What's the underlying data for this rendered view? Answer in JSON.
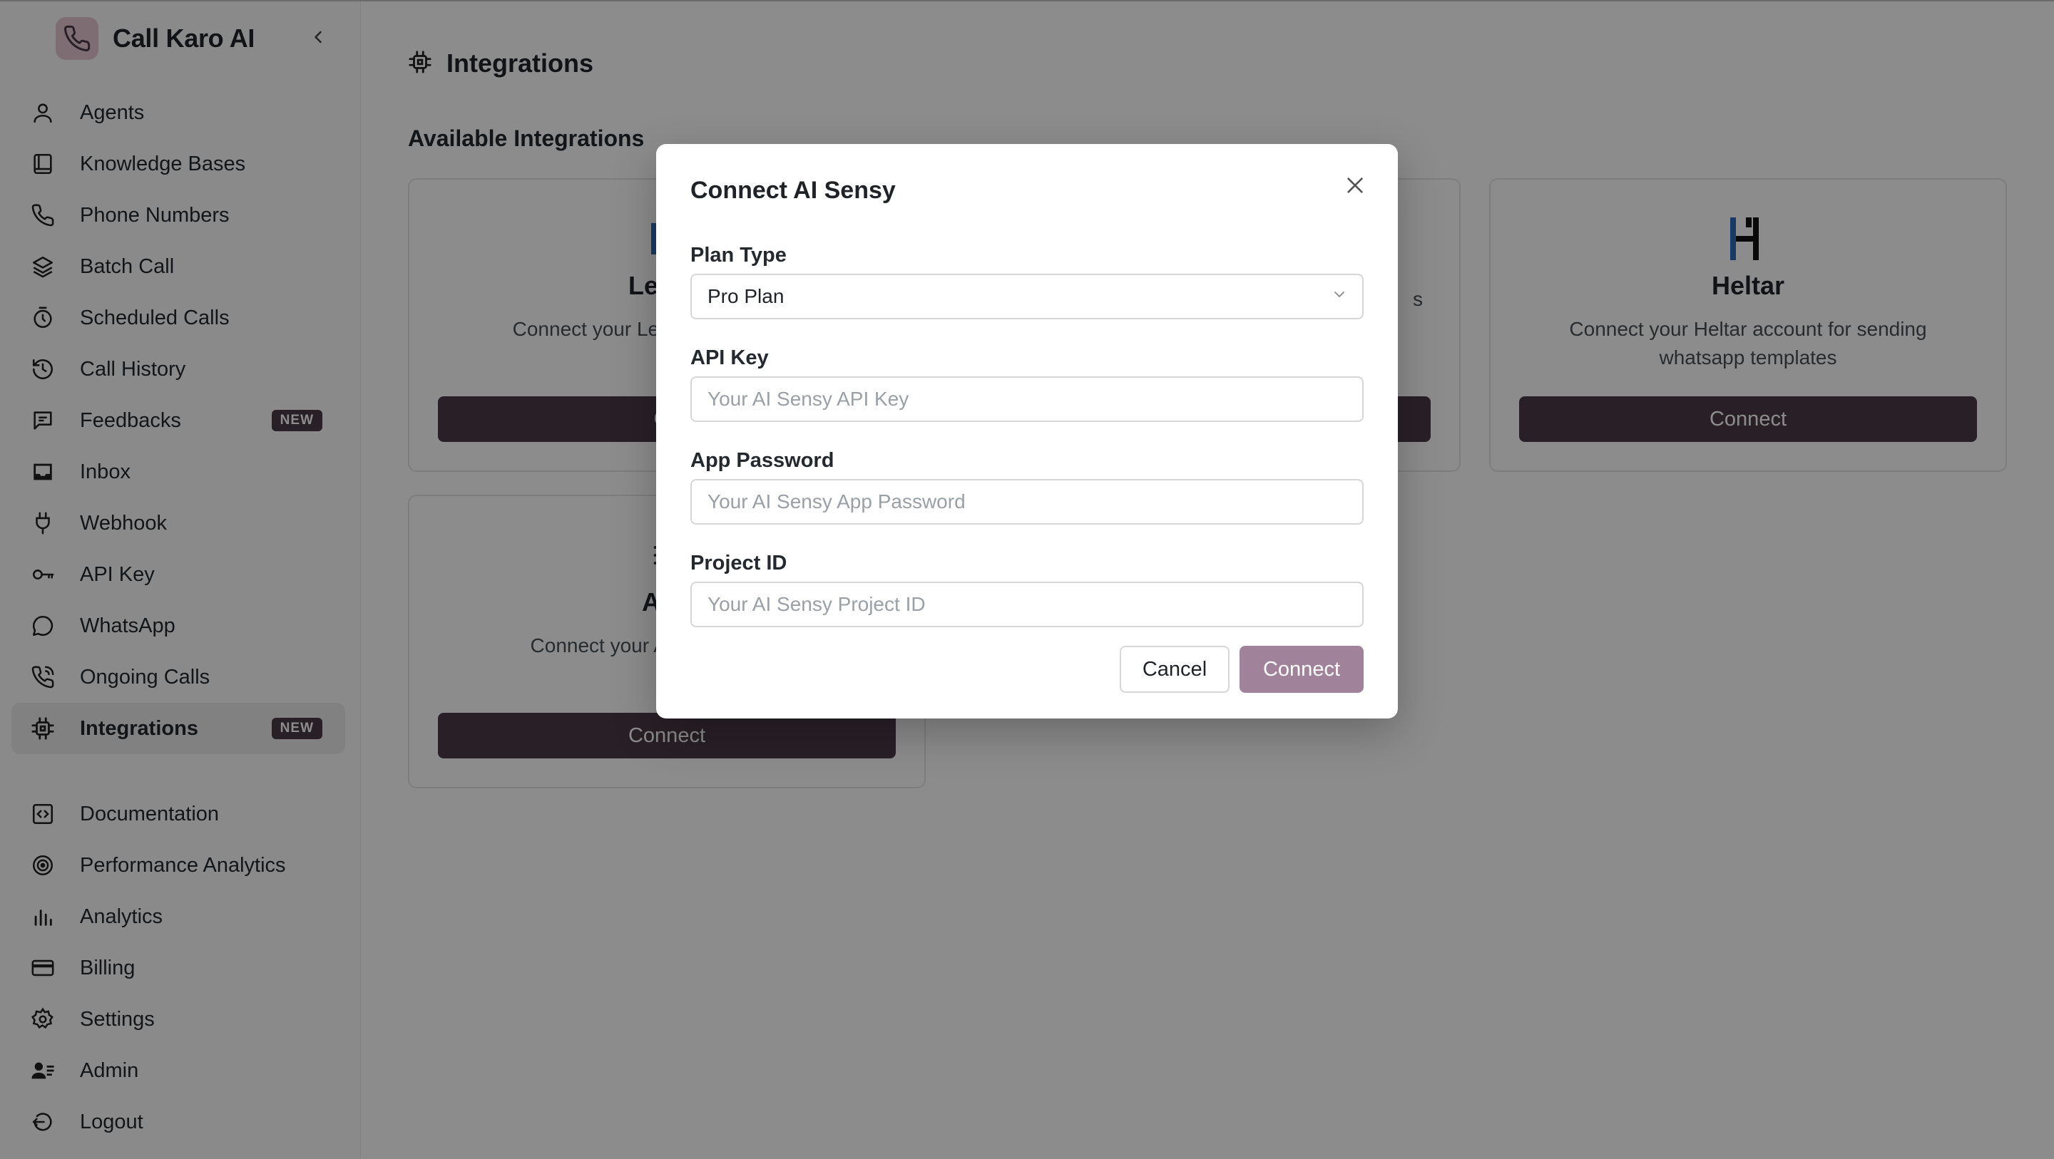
{
  "brand": {
    "name": "Call Karo AI"
  },
  "sidebar": {
    "items": [
      {
        "label": "Agents",
        "icon": "user-icon"
      },
      {
        "label": "Knowledge Bases",
        "icon": "book-icon"
      },
      {
        "label": "Phone Numbers",
        "icon": "phone-icon"
      },
      {
        "label": "Batch Call",
        "icon": "layers-icon"
      },
      {
        "label": "Scheduled Calls",
        "icon": "timer-icon"
      },
      {
        "label": "Call History",
        "icon": "history-icon"
      },
      {
        "label": "Feedbacks",
        "icon": "message-icon",
        "badge": "NEW"
      },
      {
        "label": "Inbox",
        "icon": "inbox-icon"
      },
      {
        "label": "Webhook",
        "icon": "plug-icon"
      },
      {
        "label": "API Key",
        "icon": "key-icon"
      },
      {
        "label": "WhatsApp",
        "icon": "chat-bubble-icon"
      },
      {
        "label": "Ongoing Calls",
        "icon": "phone-call-icon"
      },
      {
        "label": "Integrations",
        "icon": "chip-icon",
        "badge": "NEW",
        "active": true
      }
    ],
    "secondary": [
      {
        "label": "Documentation",
        "icon": "code-doc-icon"
      },
      {
        "label": "Performance Analytics",
        "icon": "target-icon"
      },
      {
        "label": "Analytics",
        "icon": "bar-chart-icon"
      },
      {
        "label": "Billing",
        "icon": "credit-card-icon"
      },
      {
        "label": "Settings",
        "icon": "gear-icon"
      },
      {
        "label": "Admin",
        "icon": "admin-icon"
      },
      {
        "label": "Logout",
        "icon": "logout-icon"
      }
    ]
  },
  "page": {
    "title": "Integrations",
    "section_title": "Available Integrations"
  },
  "cards": [
    {
      "name": "LeadS",
      "desc": "Connect your LeadSqu automation",
      "button": "Co"
    },
    {
      "name": "",
      "desc": "s",
      "button": ""
    },
    {
      "name": "Heltar",
      "desc": "Connect your Heltar account for sending whatsapp templates",
      "button": "Connect"
    },
    {
      "name": "AI S",
      "desc": "Connect your Ai Sen whatsapp",
      "button": "Connect"
    }
  ],
  "modal": {
    "title": "Connect AI Sensy",
    "plan_type_label": "Plan Type",
    "plan_type_value": "Pro Plan",
    "api_key_label": "API Key",
    "api_key_placeholder": "Your AI Sensy API Key",
    "app_password_label": "App Password",
    "app_password_placeholder": "Your AI Sensy App Password",
    "project_id_label": "Project ID",
    "project_id_placeholder": "Your AI Sensy Project ID",
    "cancel_label": "Cancel",
    "connect_label": "Connect"
  },
  "colors": {
    "primary": "#4b3b47",
    "primary_disabled": "#a0839a",
    "logo_bg": "#e7c7d3",
    "overlay": "rgba(0,0,0,0.45)"
  }
}
